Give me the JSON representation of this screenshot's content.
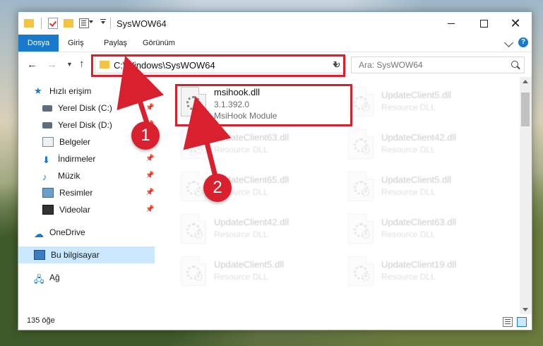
{
  "window": {
    "title": "SysWOW64"
  },
  "ribbon": {
    "tabs": [
      "Dosya",
      "Giriş",
      "Paylaş",
      "Görünüm"
    ]
  },
  "address": {
    "path": "C:\\Windows\\SysWOW64",
    "search_placeholder": "Ara: SysWOW64"
  },
  "navpane": {
    "items": [
      {
        "label": "Hızlı erişim",
        "icon": "star-icon"
      },
      {
        "label": "Yerel Disk (C:)",
        "icon": "disk-icon",
        "pinned": true
      },
      {
        "label": "Yerel Disk (D:)",
        "icon": "disk-icon",
        "pinned": true
      },
      {
        "label": "Belgeler",
        "icon": "documents-icon",
        "pinned": true
      },
      {
        "label": "İndirmeler",
        "icon": "download-icon",
        "pinned": true
      },
      {
        "label": "Müzik",
        "icon": "music-icon",
        "pinned": true
      },
      {
        "label": "Resimler",
        "icon": "pictures-icon",
        "pinned": true
      },
      {
        "label": "Videolar",
        "icon": "video-icon",
        "pinned": true
      },
      {
        "label": "OneDrive",
        "icon": "cloud-icon"
      },
      {
        "label": "Bu bilgisayar",
        "icon": "computer-icon",
        "selected": true
      },
      {
        "label": "Ağ",
        "icon": "network-icon"
      }
    ]
  },
  "files": [
    {
      "name": "msihook.dll",
      "version": "3.1.392.0",
      "description": "MsiHook Module",
      "highlighted": true
    },
    {
      "name": "UpdateClient5.dll",
      "description": "Resource DLL"
    },
    {
      "name": "UpdateClient63.dll",
      "description": "Resource DLL"
    },
    {
      "name": "UpdateClient42.dll",
      "description": "Resource DLL"
    },
    {
      "name": "UpdateClient65.dll",
      "description": "Resource DLL"
    },
    {
      "name": "UpdateClient5.dll",
      "description": "Resource DLL"
    },
    {
      "name": "UpdateClient42.dll",
      "description": "Resource DLL"
    },
    {
      "name": "UpdateClient63.dll",
      "description": "Resource DLL"
    },
    {
      "name": "UpdateClient5.dll",
      "description": "Resource DLL"
    },
    {
      "name": "UpdateClient19.dll",
      "description": "Resource DLL"
    }
  ],
  "status": {
    "count": "135 öğe"
  },
  "annotations": {
    "badge1": "1",
    "badge2": "2",
    "color": "#d8202f"
  }
}
